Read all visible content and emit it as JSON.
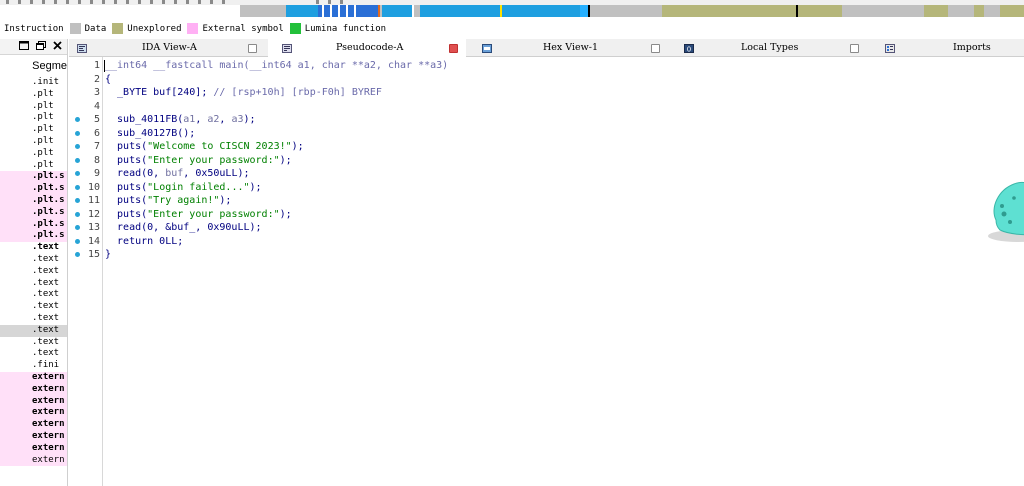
{
  "legend": [
    {
      "label": "Instruction",
      "swatch": null
    },
    {
      "label": "Data",
      "swatch": "#c0c0c0"
    },
    {
      "label": "Unexplored",
      "swatch": "#b5b67a"
    },
    {
      "label": "External symbol",
      "swatch": "#ffb0f4"
    },
    {
      "label": "Lumina function",
      "swatch": "#22c03a"
    }
  ],
  "left_panel": {
    "header": "Segme",
    "title_icons": [
      "restore-icon",
      "float-icon",
      "close-icon"
    ],
    "rows": [
      {
        "text": ".init",
        "style": "normal"
      },
      {
        "text": ".plt",
        "style": "normal"
      },
      {
        "text": ".plt",
        "style": "normal"
      },
      {
        "text": ".plt",
        "style": "normal"
      },
      {
        "text": ".plt",
        "style": "normal"
      },
      {
        "text": ".plt",
        "style": "normal"
      },
      {
        "text": ".plt",
        "style": "normal"
      },
      {
        "text": ".plt",
        "style": "normal"
      },
      {
        "text": ".plt.s",
        "style": "pink-bold"
      },
      {
        "text": ".plt.s",
        "style": "pink-bold"
      },
      {
        "text": ".plt.s",
        "style": "pink-bold"
      },
      {
        "text": ".plt.s",
        "style": "pink-bold"
      },
      {
        "text": ".plt.s",
        "style": "pink-bold"
      },
      {
        "text": ".plt.s",
        "style": "pink-bold"
      },
      {
        "text": ".text",
        "style": "bold"
      },
      {
        "text": ".text",
        "style": "normal"
      },
      {
        "text": ".text",
        "style": "normal"
      },
      {
        "text": ".text",
        "style": "normal"
      },
      {
        "text": ".text",
        "style": "normal"
      },
      {
        "text": ".text",
        "style": "normal"
      },
      {
        "text": ".text",
        "style": "normal"
      },
      {
        "text": ".text",
        "style": "selected"
      },
      {
        "text": ".text",
        "style": "normal"
      },
      {
        "text": ".text",
        "style": "normal"
      },
      {
        "text": ".fini",
        "style": "normal"
      },
      {
        "text": "extern",
        "style": "pink-bold"
      },
      {
        "text": "extern",
        "style": "pink-bold"
      },
      {
        "text": "extern",
        "style": "pink-bold"
      },
      {
        "text": "extern",
        "style": "pink-bold"
      },
      {
        "text": "extern",
        "style": "pink-bold"
      },
      {
        "text": "extern",
        "style": "pink-bold"
      },
      {
        "text": "extern",
        "style": "pink-bold"
      },
      {
        "text": "extern",
        "style": "pink"
      }
    ]
  },
  "tabs": [
    {
      "label": "IDA View-A",
      "icon": "ida-view-icon",
      "active": false
    },
    {
      "label": "Pseudocode-A",
      "icon": "pseudocode-icon",
      "active": true
    },
    {
      "label": "Hex View-1",
      "icon": "hex-view-icon",
      "active": false
    },
    {
      "label": "Local Types",
      "icon": "local-types-icon",
      "active": false
    },
    {
      "label": "Imports",
      "icon": "imports-icon",
      "active": false
    }
  ],
  "code_lines": [
    {
      "num": "1",
      "bp": false,
      "tokens": [
        {
          "t": "__int64 __fastcall main(__int64 a1, char **a2, char **a3)",
          "c": "comment"
        }
      ]
    },
    {
      "num": "2",
      "bp": false,
      "tokens": [
        {
          "t": "{",
          "c": "normal"
        }
      ]
    },
    {
      "num": "3",
      "bp": false,
      "tokens": [
        {
          "t": "  _BYTE buf[240]; ",
          "c": "normal"
        },
        {
          "t": "// [rsp+10h] [rbp-F0h] BYREF",
          "c": "comment"
        }
      ]
    },
    {
      "num": "4",
      "bp": false,
      "tokens": []
    },
    {
      "num": "5",
      "bp": true,
      "tokens": [
        {
          "t": "  sub_4011FB(",
          "c": "normal"
        },
        {
          "t": "a1",
          "c": "var"
        },
        {
          "t": ", ",
          "c": "normal"
        },
        {
          "t": "a2",
          "c": "var"
        },
        {
          "t": ", ",
          "c": "normal"
        },
        {
          "t": "a3",
          "c": "var"
        },
        {
          "t": ");",
          "c": "normal"
        }
      ]
    },
    {
      "num": "6",
      "bp": true,
      "tokens": [
        {
          "t": "  sub_40127B();",
          "c": "normal"
        }
      ]
    },
    {
      "num": "7",
      "bp": true,
      "tokens": [
        {
          "t": "  puts(",
          "c": "normal"
        },
        {
          "t": "\"Welcome to CISCN 2023!\"",
          "c": "string"
        },
        {
          "t": ");",
          "c": "normal"
        }
      ]
    },
    {
      "num": "8",
      "bp": true,
      "tokens": [
        {
          "t": "  puts(",
          "c": "normal"
        },
        {
          "t": "\"Enter your password:\"",
          "c": "string"
        },
        {
          "t": ");",
          "c": "normal"
        }
      ]
    },
    {
      "num": "9",
      "bp": true,
      "tokens": [
        {
          "t": "  read(0, ",
          "c": "normal"
        },
        {
          "t": "buf",
          "c": "var"
        },
        {
          "t": ", 0x50uLL);",
          "c": "normal"
        }
      ]
    },
    {
      "num": "10",
      "bp": true,
      "tokens": [
        {
          "t": "  puts(",
          "c": "normal"
        },
        {
          "t": "\"Login failed...\"",
          "c": "string"
        },
        {
          "t": ");",
          "c": "normal"
        }
      ]
    },
    {
      "num": "11",
      "bp": true,
      "tokens": [
        {
          "t": "  puts(",
          "c": "normal"
        },
        {
          "t": "\"Try again!\"",
          "c": "string"
        },
        {
          "t": ");",
          "c": "normal"
        }
      ]
    },
    {
      "num": "12",
      "bp": true,
      "tokens": [
        {
          "t": "  puts(",
          "c": "normal"
        },
        {
          "t": "\"Enter your password:\"",
          "c": "string"
        },
        {
          "t": ");",
          "c": "normal"
        }
      ]
    },
    {
      "num": "13",
      "bp": true,
      "tokens": [
        {
          "t": "  read(0, &buf_, 0x90uLL);",
          "c": "normal"
        }
      ]
    },
    {
      "num": "14",
      "bp": true,
      "tokens": [
        {
          "t": "  return 0LL;",
          "c": "normal"
        }
      ]
    },
    {
      "num": "15",
      "bp": true,
      "tokens": [
        {
          "t": "}",
          "c": "normal"
        }
      ]
    }
  ],
  "colors": {
    "breakpoint": "#27a4d6",
    "string": "#008000",
    "code": "#000080",
    "comment": "#6a6aaa",
    "external_symbol": "#ffb0f4",
    "unexplored": "#b5b67a",
    "lumina": "#22c03a",
    "navband_code": "#1e9fe0"
  }
}
